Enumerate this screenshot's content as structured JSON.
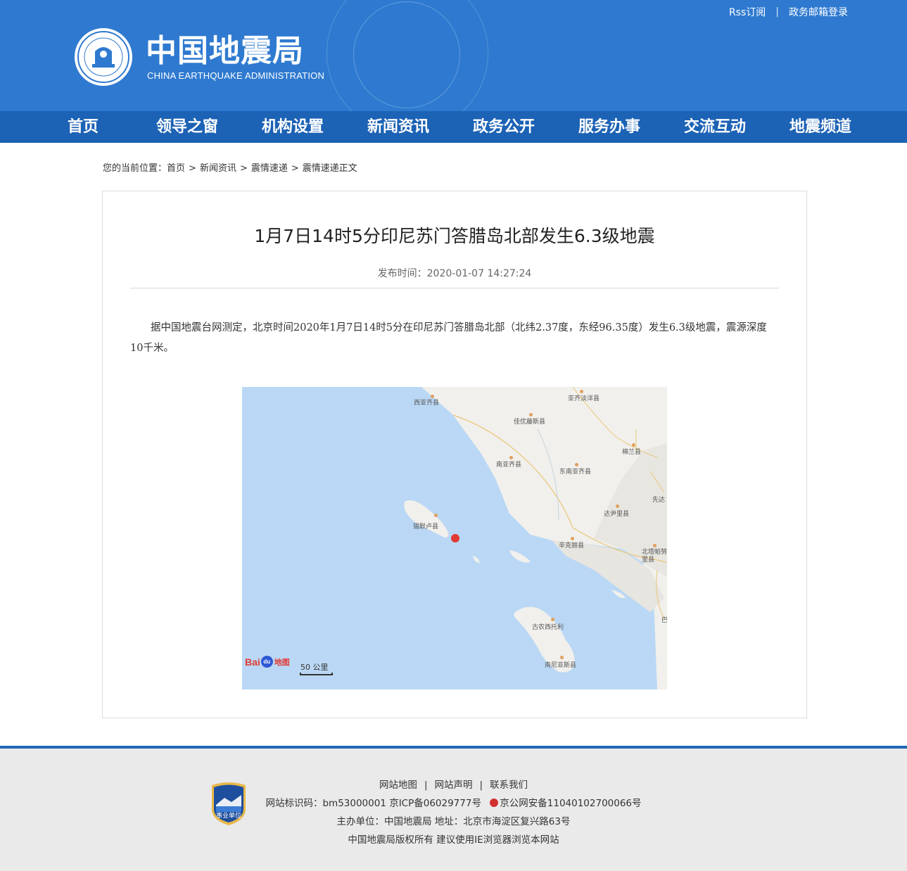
{
  "header": {
    "logo_cn": "中国地震局",
    "logo_en": "CHINA EARTHQUAKE ADMINISTRATION",
    "links": [
      "Rss订阅",
      "政务邮箱登录"
    ]
  },
  "nav": {
    "items": [
      "首页",
      "领导之窗",
      "机构设置",
      "新闻资讯",
      "政务公开",
      "服务办事",
      "交流互动",
      "地震频道"
    ]
  },
  "breadcrumb": {
    "prefix": "您的当前位置：",
    "items": [
      "首页",
      "新闻资讯",
      "震情速递",
      "震情速递正文"
    ],
    "sep": ">"
  },
  "article": {
    "title": "1月7日14时5分印尼苏门答腊岛北部发生6.3级地震",
    "date": "发布时间：2020-01-07 14:27:24",
    "body": "据中国地震台网测定，北京时间2020年1月7日14时5分在印尼苏门答腊岛北部（北纬2.37度，东经96.35度）发生6.3级地震，震源深度10千米。"
  },
  "map": {
    "labels": [
      "西亚齐县",
      "亚齐淡洋县",
      "佳优藤斯县",
      "棉兰县",
      "南亚齐县",
      "东南亚齐县",
      "先达",
      "达尹里县",
      "锡默卢县",
      "辛克丽县",
      "北塔帕努里县",
      "巴",
      "古农西托利",
      "南尼亚斯县"
    ],
    "baidu_logo": "Bai",
    "baidu_logo_suffix": "地图",
    "scale": "50 公里",
    "colors": {
      "sea": "#bad8f5",
      "land": "#f1f0ec",
      "quake": "#e23a34"
    }
  },
  "footer": {
    "links": [
      "网站地图",
      "网站声明",
      "联系我们"
    ],
    "line2": "网站标识码：bm53000001   京ICP备06029777号",
    "police": "京公网安备11040102700066号",
    "line3": "主办单位：中国地震局  地址：北京市海淀区复兴路63号",
    "line4": "中国地震局版权所有   建议使用IE浏览器浏览本网站",
    "badge_text": "事业单位"
  }
}
